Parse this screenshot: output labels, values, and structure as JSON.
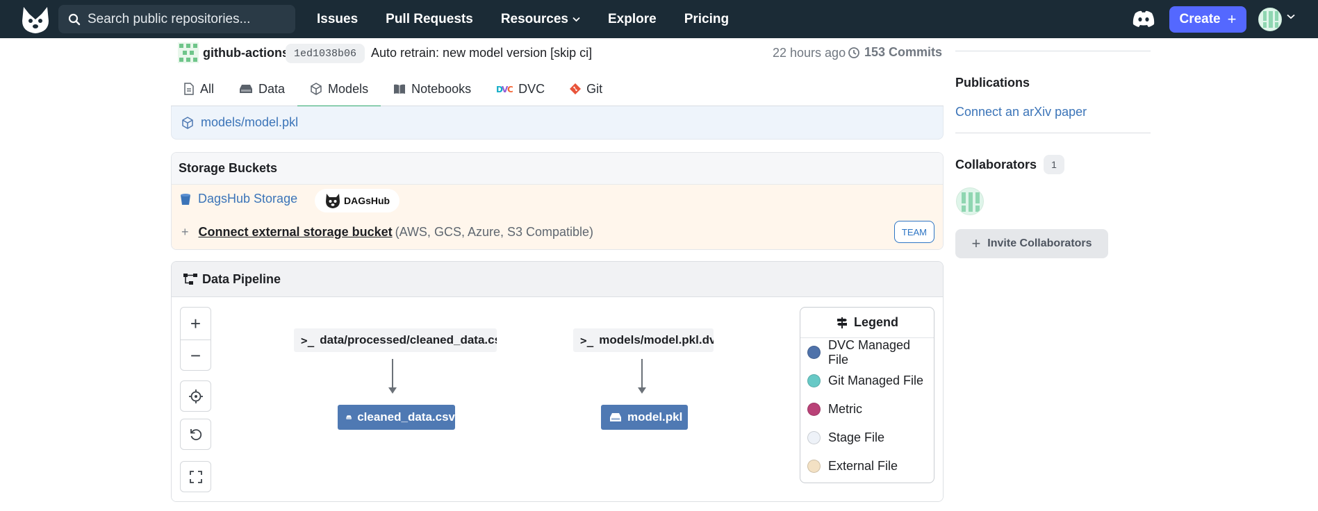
{
  "topnav": {
    "search_placeholder": "Search public repositories...",
    "links": [
      "Issues",
      "Pull Requests",
      "Resources",
      "Explore",
      "Pricing"
    ],
    "create_label": "Create",
    "create_plus": "+"
  },
  "commit": {
    "author": "github-actions",
    "hash": "1ed1038b06",
    "message": "Auto retrain: new model version [skip ci]",
    "time": "22 hours ago",
    "count": "153 Commits"
  },
  "tabs": [
    {
      "label": "All",
      "icon": "document-icon"
    },
    {
      "label": "Data",
      "icon": "database-icon"
    },
    {
      "label": "Models",
      "icon": "model-cube-icon",
      "active": true
    },
    {
      "label": "Notebooks",
      "icon": "book-icon"
    },
    {
      "label": "DVC",
      "icon": "dvc-logo-icon"
    },
    {
      "label": "Git",
      "icon": "git-icon"
    }
  ],
  "file": {
    "path": "models/model.pkl"
  },
  "storage": {
    "title": "Storage Buckets",
    "bucket": "DagsHub Storage",
    "badge": "DAGsHub",
    "connect_link": "Connect external storage bucket",
    "connect_hint": "(AWS, GCS, Azure, S3 Compatible)",
    "plus": "+",
    "team_badge": "TEAM"
  },
  "pipeline": {
    "title": "Data Pipeline",
    "zoom_in": "+",
    "zoom_out": "−",
    "stages": [
      "data/processed/cleaned_data.csv",
      "models/model.pkl.dvc"
    ],
    "outputs": [
      "cleaned_data.csv",
      "model.pkl"
    ],
    "terminal_glyph": ">_",
    "legend": {
      "title": "Legend",
      "items": [
        {
          "label": "DVC Managed File",
          "color": "#4f72aa"
        },
        {
          "label": "Git Managed File",
          "color": "#67c9c6"
        },
        {
          "label": "Metric",
          "color": "#b94177"
        },
        {
          "label": "Stage File",
          "color": "#eef2f8"
        },
        {
          "label": "External File",
          "color": "#f3e1c4"
        }
      ]
    }
  },
  "sidebar": {
    "publications_title": "Publications",
    "publications_link": "Connect an arXiv paper",
    "collaborators_title": "Collaborators",
    "collaborators_count": "1",
    "invite_label": "Invite Collaborators",
    "invite_plus": "+"
  },
  "colors": {
    "nav_bg": "#1b2b36",
    "create_button": "#5468ff",
    "link": "#3b74b8",
    "active_tab": "#2ca66b",
    "dvc_node": "#4f79b3"
  }
}
